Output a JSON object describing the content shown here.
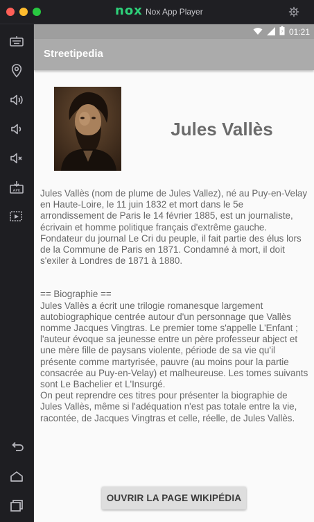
{
  "window": {
    "app_name": "Nox App Player",
    "logo_text": "nox"
  },
  "sidebar": {
    "icons": [
      "keyboard-icon",
      "location-icon",
      "volume-up-icon",
      "volume-down-icon",
      "mute-icon",
      "apk-install-icon",
      "screen-record-icon"
    ],
    "bottom_icons": [
      "back-icon",
      "home-icon",
      "recent-apps-icon"
    ]
  },
  "status_bar": {
    "time": "01:21",
    "icons": [
      "wifi-icon",
      "signal-icon",
      "battery-icon"
    ]
  },
  "app_bar": {
    "title": "Streetipedia"
  },
  "article": {
    "name": "Jules Vallès",
    "intro": "Jules Vallès (nom de plume de Jules Vallez), né au Puy-en-Velay en Haute-Loire, le 11 juin 1832 et mort dans le 5e arrondissement de Paris le 14 février 1885, est un journaliste, écrivain et homme politique français d'extrême gauche.\nFondateur du journal Le Cri du peuple, il fait partie des élus lors de la Commune de Paris en 1871. Condamné à mort, il doit s'exiler à Londres de 1871 à 1880.",
    "bio": "== Biographie ==\nJules Vallès a écrit une trilogie romanesque largement autobiographique centrée autour d'un personnage que Vallès nomme Jacques Vingtras. Le premier tome s'appelle L'Enfant ; l'auteur évoque sa jeunesse entre un père professeur abject et une mère fille de paysans violente, période de sa vie qu'il présente comme martyrisée, pauvre (au moins pour la partie consacrée au Puy-en-Velay) et malheureuse. Les tomes suivants sont Le Bachelier et L'Insurgé.\nOn peut reprendre ces titres pour présenter la biographie de Jules Vallès, même si l'adéquation n'est pas totale entre la vie, racontée, de Jacques Vingtras et celle, réelle, de Jules Vallès."
  },
  "button": {
    "label": "OUVRIR LA PAGE WIKIPÉDIA"
  }
}
